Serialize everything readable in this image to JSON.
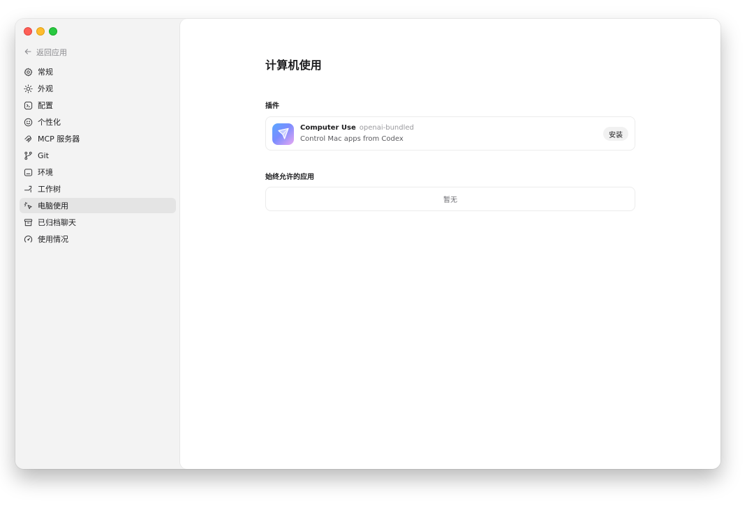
{
  "sidebar": {
    "back_label": "返回应用",
    "items": [
      {
        "label": "常规",
        "icon": "gear-icon"
      },
      {
        "label": "外观",
        "icon": "sun-icon"
      },
      {
        "label": "配置",
        "icon": "config-icon"
      },
      {
        "label": "个性化",
        "icon": "personalize-icon"
      },
      {
        "label": "MCP 服务器",
        "icon": "mcp-icon"
      },
      {
        "label": "Git",
        "icon": "git-branch-icon"
      },
      {
        "label": "环境",
        "icon": "environment-icon"
      },
      {
        "label": "工作树",
        "icon": "worktree-icon"
      },
      {
        "label": "电脑使用",
        "icon": "computer-use-icon",
        "active": true
      },
      {
        "label": "已归档聊天",
        "icon": "archive-icon"
      },
      {
        "label": "使用情况",
        "icon": "gauge-icon"
      }
    ]
  },
  "main": {
    "title": "计算机使用",
    "plugins_heading": "插件",
    "plugin": {
      "name": "Computer Use",
      "source": "openai-bundled",
      "description": "Control Mac apps from Codex",
      "install_label": "安装"
    },
    "allowed_heading": "始终允许的应用",
    "allowed_empty": "暂无"
  }
}
